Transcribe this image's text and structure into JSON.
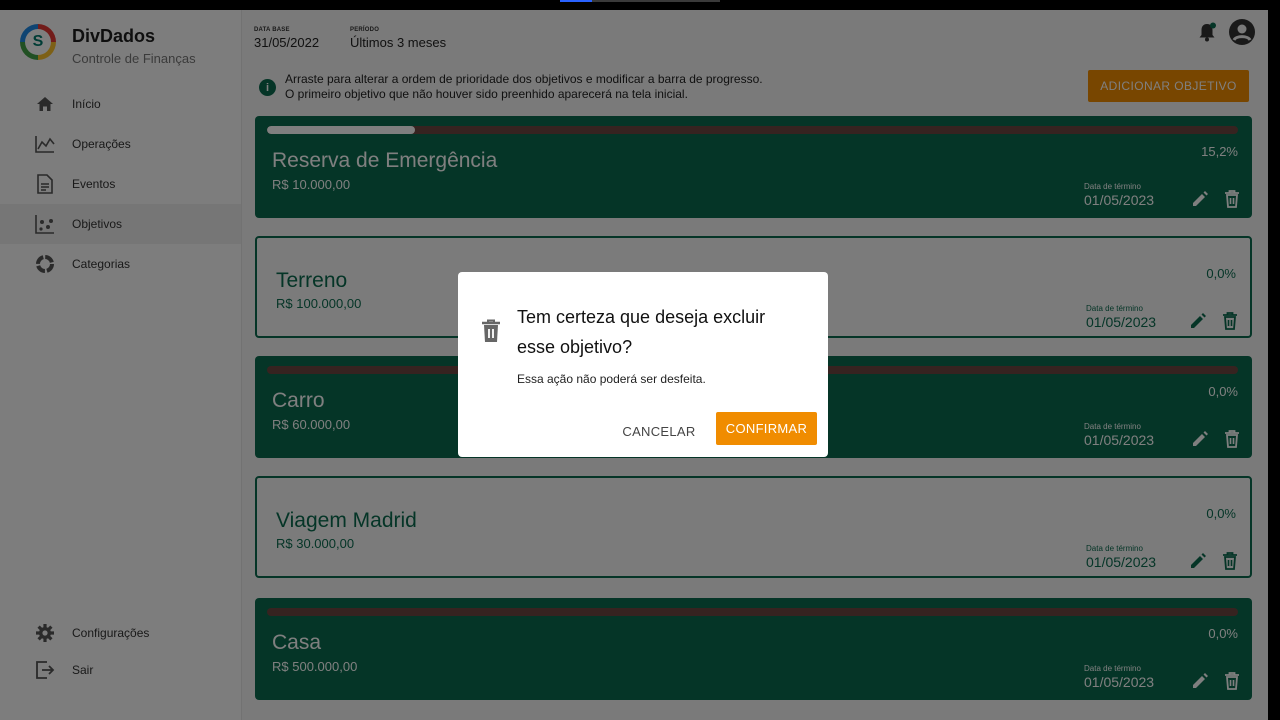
{
  "app": {
    "name": "DivDados",
    "subtitle": "Controle de Finanças",
    "logo_letter": "S"
  },
  "sidebar": {
    "items": [
      {
        "label": "Início",
        "icon": "home-icon",
        "active": false
      },
      {
        "label": "Operações",
        "icon": "chart-line-icon",
        "active": false
      },
      {
        "label": "Eventos",
        "icon": "document-icon",
        "active": false
      },
      {
        "label": "Objetivos",
        "icon": "scatter-icon",
        "active": true
      },
      {
        "label": "Categorias",
        "icon": "donut-icon",
        "active": false
      }
    ],
    "bottom_items": [
      {
        "label": "Configurações",
        "icon": "gear-icon"
      },
      {
        "label": "Sair",
        "icon": "logout-icon"
      }
    ]
  },
  "header": {
    "base_date_label": "DATA BASE",
    "base_date": "31/05/2022",
    "period_label": "PERÍODO",
    "period": "Últimos 3 meses"
  },
  "info": {
    "line1": "Arraste para alterar a ordem de prioridade dos objetivos e modificar a barra de progresso.",
    "line2": "O primeiro objetivo que não houver sido preenhido aparecerá na tela inicial.",
    "icon": "info-icon"
  },
  "add_button": "ADICIONAR OBJETIVO",
  "goals": [
    {
      "name": "Reserva de Emergência",
      "amount": "R$ 10.000,00",
      "percent": "15,2%",
      "progress": 0.152,
      "end_label": "Data de término",
      "end_date": "01/05/2023",
      "style": "filled"
    },
    {
      "name": "Terreno",
      "amount": "R$ 100.000,00",
      "percent": "0,0%",
      "progress": 0,
      "end_label": "Data de término",
      "end_date": "01/05/2023",
      "style": "outline"
    },
    {
      "name": "Carro",
      "amount": "R$ 60.000,00",
      "percent": "0,0%",
      "progress": 0,
      "end_label": "Data de término",
      "end_date": "01/05/2023",
      "style": "filled"
    },
    {
      "name": "Viagem Madrid",
      "amount": "R$ 30.000,00",
      "percent": "0,0%",
      "progress": 0,
      "end_label": "Data de término",
      "end_date": "01/05/2023",
      "style": "outline"
    },
    {
      "name": "Casa",
      "amount": "R$ 500.000,00",
      "percent": "0,0%",
      "progress": 0,
      "end_label": "Data de término",
      "end_date": "01/05/2023",
      "style": "filled"
    }
  ],
  "dialog": {
    "title": "Tem certeza que deseja excluir esse objetivo?",
    "message": "Essa ação não poderá ser desfeita.",
    "cancel": "CANCELAR",
    "confirm": "CONFIRMAR",
    "icon": "trash-icon"
  },
  "colors": {
    "primary": "#0b6b4f",
    "accent": "#f08c00",
    "progress_track": "#6c4640"
  }
}
